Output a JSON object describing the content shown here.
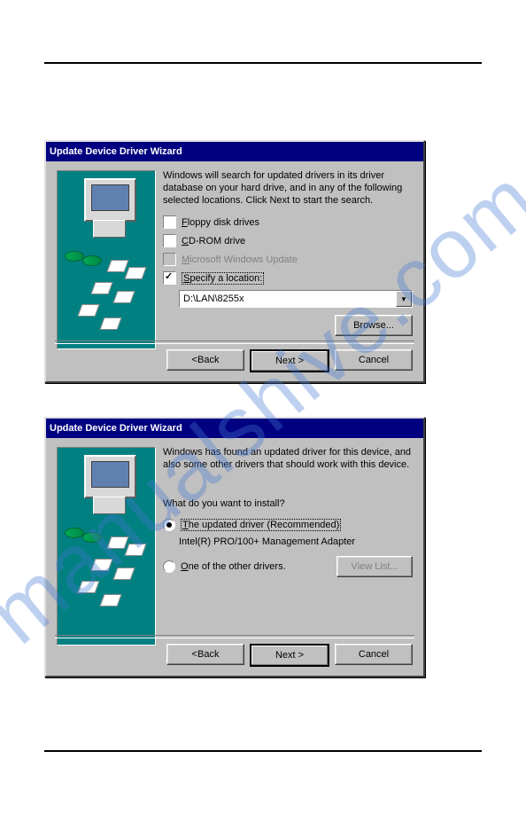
{
  "watermark": "manualshive.com",
  "dialog1": {
    "title": "Update Device Driver Wizard",
    "intro": "Windows will search for updated drivers in its driver database on your hard drive, and in any of the following selected locations. Click Next to start the search.",
    "opt_floppy": "Floppy disk drives",
    "opt_cdrom": "CD-ROM drive",
    "opt_msupdate": "Microsoft Windows Update",
    "opt_location": "Specify a location:",
    "path_value": "D:\\LAN\\8255x",
    "btn_browse": "Browse...",
    "btn_back": "< Back",
    "btn_next": "Next >",
    "btn_cancel": "Cancel"
  },
  "dialog2": {
    "title": "Update Device Driver Wizard",
    "intro": "Windows has found an updated driver for this device, and also some other drivers that should work with this device.",
    "question": "What do you want to install?",
    "opt_recommended": "The updated driver (Recommended)",
    "driver_name": "Intel(R) PRO/100+ Management Adapter",
    "opt_other": "One of the other drivers.",
    "btn_viewlist": "View List...",
    "btn_back": "< Back",
    "btn_next": "Next >",
    "btn_cancel": "Cancel"
  }
}
